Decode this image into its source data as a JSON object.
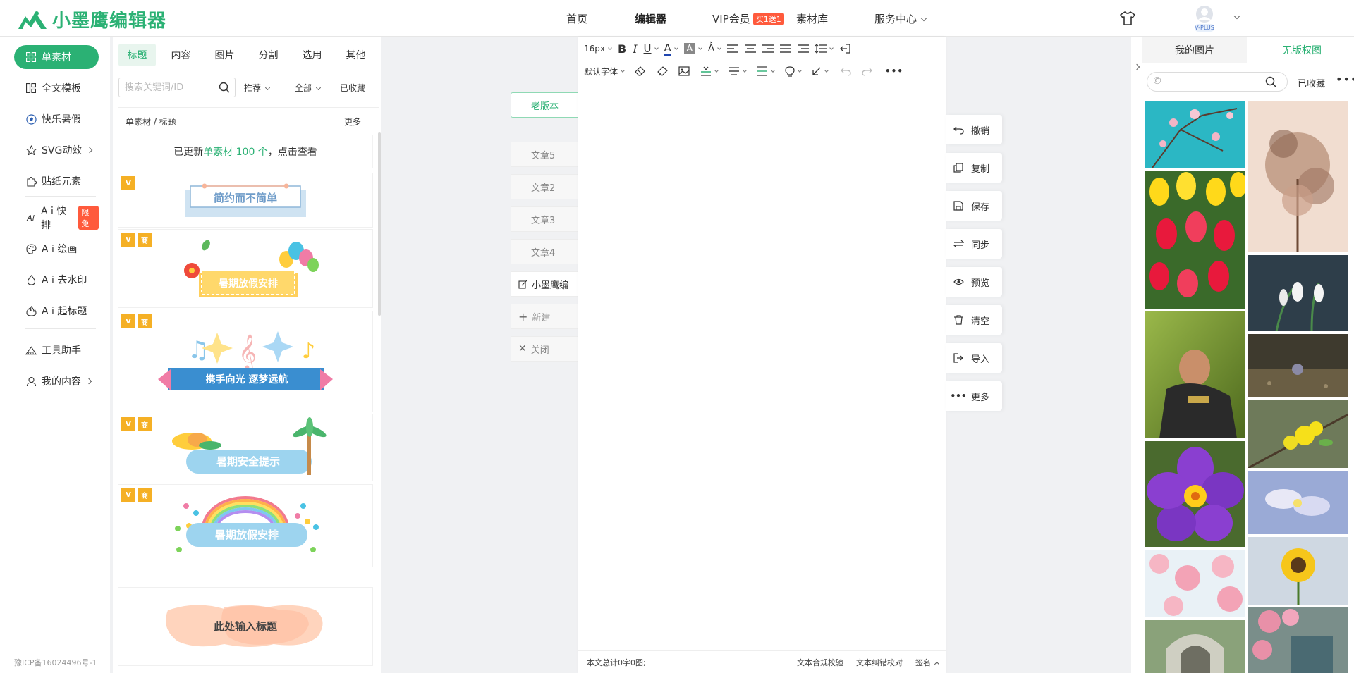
{
  "topnav": {
    "logo_text": "小墨鹰编辑器",
    "items": [
      "首页",
      "编辑器",
      "VIP会员",
      "素材库",
      "服务中心"
    ],
    "vip_badge": "买1送1",
    "avatar_label": "V-PLUS"
  },
  "sidebar": {
    "items": [
      "单素材",
      "全文模板",
      "快乐暑假",
      "SVG动效",
      "贴纸元素",
      "A i 快排",
      "A i 绘画",
      "A i 去水印",
      "A i 起标题",
      "工具助手",
      "我的内容"
    ],
    "limited_badge": "限免",
    "icp": "豫ICP备16024496号-1"
  },
  "panel": {
    "tabs": [
      "标题",
      "内容",
      "图片",
      "分割",
      "选用",
      "其他"
    ],
    "search_placeholder": "搜索关键词/ID",
    "filters": [
      "推荐",
      "全部",
      "已收藏"
    ],
    "breadcrumb": "单素材 / 标题",
    "more": "更多",
    "notice_prefix": "已更新",
    "notice_highlight": "单素材 100 个",
    "notice_suffix": "，点击查看",
    "badge_v": "V",
    "badge_biz": "商",
    "cards": [
      "简约而不简单",
      "暑期放假安排",
      "携手向光 逐梦远航",
      "暑期安全提示",
      "暑期放假安排",
      "此处输入标题"
    ]
  },
  "docs": {
    "version": "老版本",
    "items": [
      "文章5",
      "文章2",
      "文章3",
      "文章4"
    ],
    "current": "小墨鹰编",
    "new": "新建",
    "close": "关闭"
  },
  "editor": {
    "font_size": "16px",
    "font_family": "默认字体",
    "status_count": "本文总计0字0图;",
    "status_actions": [
      "文本合规校验",
      "文本纠错校对",
      "签名"
    ]
  },
  "actions": [
    "撤销",
    "复制",
    "保存",
    "同步",
    "预览",
    "清空",
    "导入",
    "更多"
  ],
  "right_panel": {
    "tabs": [
      "我的图片",
      "无版权图"
    ],
    "search_prefix": "©",
    "favorites": "已收藏",
    "more": "•••"
  },
  "colors": {
    "brand": "#2bb174",
    "badge": "#ff5a3c",
    "gold": "#f5b025"
  }
}
